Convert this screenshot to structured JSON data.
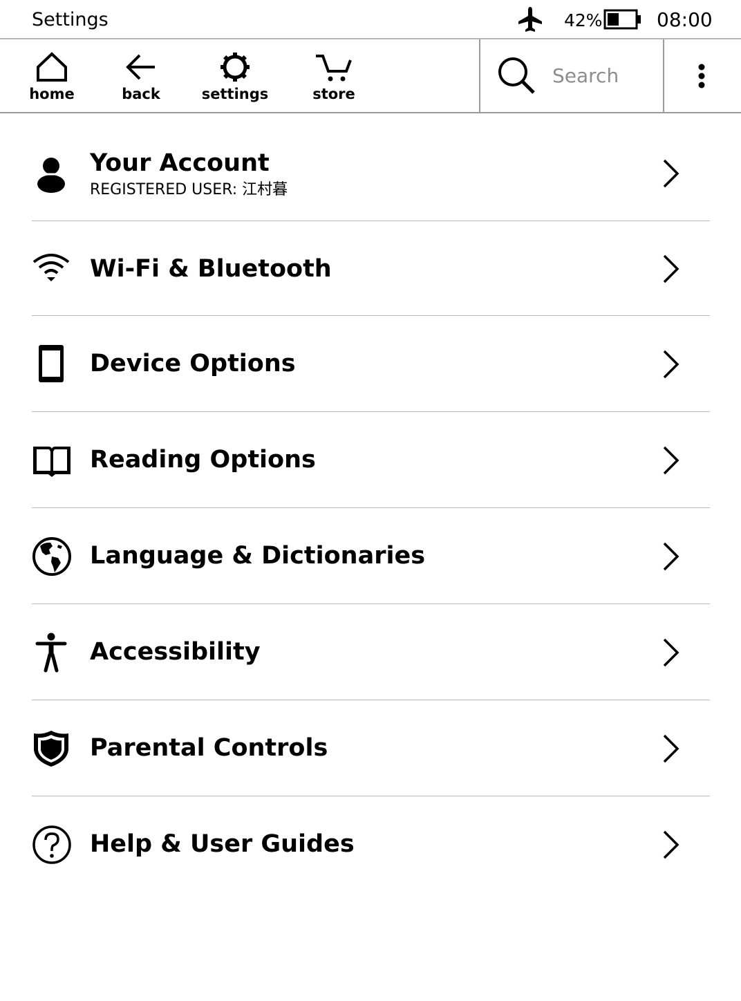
{
  "status_bar": {
    "title": "Settings",
    "airplane_icon": "airplane-icon",
    "battery_percent": "42%",
    "battery_level": 0.42,
    "time": "08:00"
  },
  "toolbar": {
    "home_label": "home",
    "back_label": "back",
    "settings_label": "settings",
    "store_label": "store",
    "search_placeholder": "Search",
    "more_icon": "more-vertical-icon"
  },
  "settings": {
    "items": [
      {
        "label": "Your Account",
        "sublabel": "REGISTERED USER: 江村暮",
        "icon": "person-icon"
      },
      {
        "label": "Wi-Fi & Bluetooth",
        "icon": "wifi-icon"
      },
      {
        "label": "Device Options",
        "icon": "device-icon"
      },
      {
        "label": "Reading Options",
        "icon": "book-icon"
      },
      {
        "label": "Language & Dictionaries",
        "icon": "globe-icon"
      },
      {
        "label": "Accessibility",
        "icon": "accessibility-icon"
      },
      {
        "label": "Parental Controls",
        "icon": "shield-icon"
      },
      {
        "label": "Help & User Guides",
        "icon": "help-icon"
      }
    ]
  },
  "colors": {
    "text": "#000000",
    "background": "#ffffff",
    "divider": "#b8b8b8",
    "placeholder": "#8d8d8d"
  }
}
